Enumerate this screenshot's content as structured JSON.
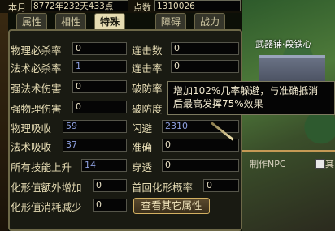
{
  "header": {
    "month_label": "本月",
    "month_value": "8772年232天433点",
    "points_label": "点数",
    "points_value": "1310026"
  },
  "tabs": [
    {
      "label": "属性",
      "active": false
    },
    {
      "label": "相性",
      "active": false
    },
    {
      "label": "特殊",
      "active": true
    },
    {
      "label": "障碍",
      "active": false
    },
    {
      "label": "战力",
      "active": false
    }
  ],
  "left_stats": [
    {
      "label": "物理必杀率",
      "value": "0",
      "color": "normal"
    },
    {
      "label": "法术必杀率",
      "value": "1",
      "color": "blue"
    },
    {
      "label": "强法术伤害",
      "value": "0",
      "color": "normal"
    },
    {
      "label": "强物理伤害",
      "value": "0",
      "color": "normal"
    },
    {
      "label": "物理吸收",
      "value": "59",
      "color": "blue"
    },
    {
      "label": "法术吸收",
      "value": "37",
      "color": "blue"
    },
    {
      "label": "所有技能上升",
      "value": "14",
      "color": "blue"
    },
    {
      "label": "化形值额外增加",
      "value": "0",
      "color": "normal"
    },
    {
      "label": "化形值消耗减少",
      "value": "0",
      "color": "normal"
    }
  ],
  "right_stats": [
    {
      "label": "连击数",
      "value": "0",
      "color": "normal"
    },
    {
      "label": "连击率",
      "value": "0",
      "color": "normal"
    },
    {
      "label": "破防率",
      "value": "",
      "color": "normal"
    },
    {
      "label": "破防度",
      "value": "",
      "color": "normal"
    },
    {
      "label": "闪避",
      "value": "2310",
      "color": "blue"
    },
    {
      "label": "准确",
      "value": "0",
      "color": "normal"
    },
    {
      "label": "穿透",
      "value": "0",
      "color": "normal"
    },
    {
      "label": "首回化形概率",
      "value": "0",
      "color": "normal"
    }
  ],
  "view_other_button": "查看其它属性",
  "tooltip": {
    "line1": "增加102%几率躲避，与准确抵消",
    "line2": "后最高发挥75%效果"
  },
  "background": {
    "shop_sign": "武器铺·段铁心",
    "npc_label": "制作NPC",
    "other_label": "其"
  }
}
